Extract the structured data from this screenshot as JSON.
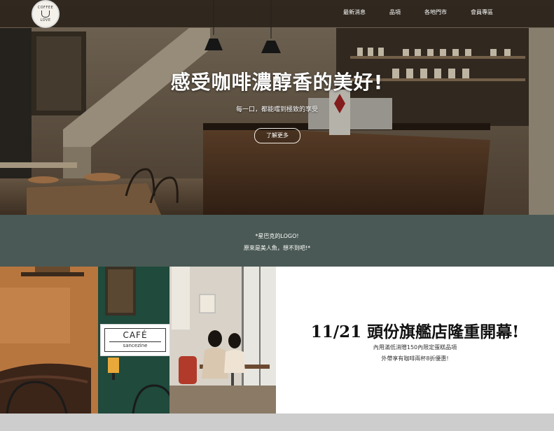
{
  "nav": {
    "logo": {
      "top_text": "COFFEE",
      "bottom_text": "LOVE"
    },
    "links": [
      "最新消息",
      "品項",
      "各地門市",
      "會員專區"
    ]
  },
  "hero": {
    "title": "感受咖啡濃醇香的美好!",
    "subtitle": "每一口，都能嚐到極致的享受",
    "button_label": "了解更多"
  },
  "band": {
    "line1": "*星巴克的LOGO!",
    "line2": "原來是美人魚，想不到吧!*"
  },
  "feature": {
    "sign_title": "CAFÉ",
    "sign_subtitle": "sancezine",
    "title": "11/21 頭份旗艦店隆重開幕!",
    "line1": "內用滿低消贈150內限定蛋糕品項",
    "line2": "外帶享有咖啡兩杯8折優惠!"
  },
  "colors": {
    "nav_bg": "#2a2018",
    "band_bg": "#4a5955",
    "footer_bg": "#cdcdcd"
  }
}
